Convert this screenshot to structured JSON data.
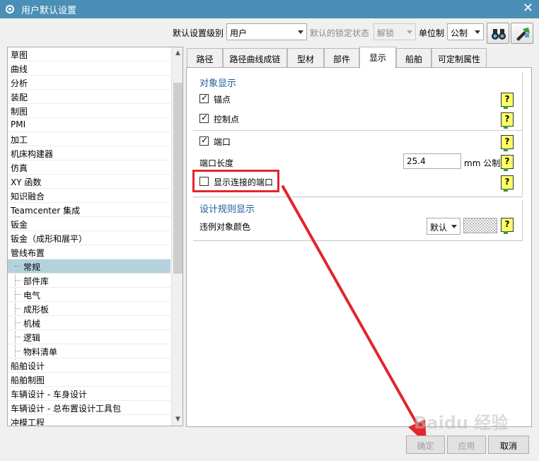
{
  "window": {
    "title": "用户默认设置",
    "close_glyph": "✕"
  },
  "toolbar": {
    "level_label": "默认设置级别",
    "level_value": "用户",
    "lock_label": "默认的锁定状态",
    "lock_value": "解锁",
    "unit_label": "单位制",
    "unit_value": "公制",
    "btn1_icon": "binoculars-icon",
    "btn2_icon": "manager-mode-icon"
  },
  "tree": {
    "items": [
      {
        "label": "草图"
      },
      {
        "label": "曲线"
      },
      {
        "label": "分析"
      },
      {
        "label": "装配"
      },
      {
        "label": "制图"
      },
      {
        "label": "PMI"
      },
      {
        "label": "加工"
      },
      {
        "label": "机床构建器"
      },
      {
        "label": "仿真"
      },
      {
        "label": "XY 函数"
      },
      {
        "label": "知识融合"
      },
      {
        "label": "Teamcenter 集成"
      },
      {
        "label": "钣金"
      },
      {
        "label": "钣金（成形和展平）"
      },
      {
        "label": "管线布置"
      },
      {
        "label": "常规"
      },
      {
        "label": "部件库"
      },
      {
        "label": "电气"
      },
      {
        "label": "成形板"
      },
      {
        "label": "机械"
      },
      {
        "label": "逻辑"
      },
      {
        "label": "物料清单"
      },
      {
        "label": "船舶设计"
      },
      {
        "label": "船舶制图"
      },
      {
        "label": "车辆设计 - 车身设计"
      },
      {
        "label": "车辆设计 - 总布置设计工具包"
      },
      {
        "label": "冲模工程"
      }
    ],
    "selected": "常规"
  },
  "tabs": [
    {
      "label": "路径"
    },
    {
      "label": "路径曲线成链"
    },
    {
      "label": "型材"
    },
    {
      "label": "部件"
    },
    {
      "label": "显示"
    },
    {
      "label": "船舶"
    },
    {
      "label": "可定制属性"
    }
  ],
  "active_tab": "显示",
  "panel": {
    "object_display": {
      "title": "对象显示",
      "anchor": {
        "label": "锚点",
        "checked": true
      },
      "control_point": {
        "label": "控制点",
        "checked": true
      },
      "port": {
        "label": "端口",
        "checked": true
      },
      "port_length_label": "端口长度",
      "port_length_value": "25.4",
      "port_length_unit": "mm 公制",
      "show_connected_ports": {
        "label": "显示连接的端口",
        "checked": false
      }
    },
    "design_rule_display": {
      "title": "设计规则显示",
      "violation_color_label": "违例对象颜色",
      "violation_color_value": "默认"
    },
    "help_glyph": "?"
  },
  "buttons": {
    "ok": "确定",
    "apply": "应用",
    "cancel": "取消"
  },
  "watermark": "Baidu 经验",
  "colors": {
    "titlebar": "#4a8fb5",
    "highlight": "#e2262c",
    "selection": "#b4d2dc",
    "group_title": "#1e5a99"
  }
}
